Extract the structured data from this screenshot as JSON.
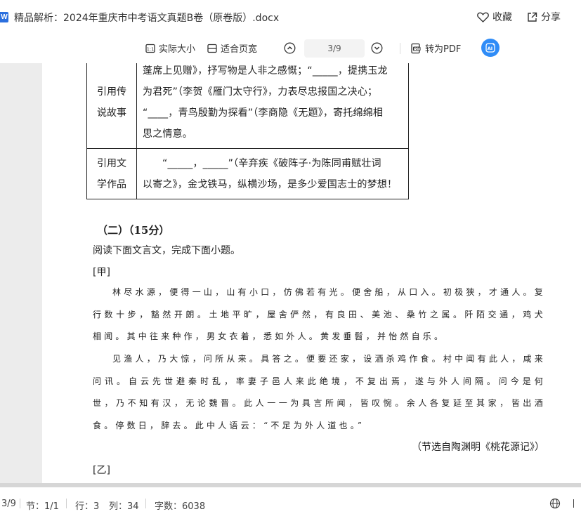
{
  "window": {
    "title": "精品解析：2024年重庆市中考语文真题B卷（原卷版）.docx",
    "app_icon_letter": "W",
    "actions": {
      "favorite": "收藏",
      "share": "分享"
    }
  },
  "toolbar": {
    "actual_size": "实际大小",
    "fit_width": "适合页宽",
    "page_indicator": "3/9",
    "to_pdf": "转为PDF",
    "ai_label": "AI"
  },
  "document": {
    "table": {
      "rows": [
        {
          "category": "引用传说故事",
          "category_lines": [
            "引用传",
            "说故事"
          ],
          "lines": [
            "蓬席上见赠》，抒写物是人非之感慨；“_____，提携玉龙",
            "为君死”（李贺《雁门太守行》，力表尽忠报国之决心；",
            "“____，青鸟殷勤为探看”（李商隐《无题》，寄托绵绵相",
            "思之情意。"
          ]
        },
        {
          "category": "引用文学作品",
          "category_lines": [
            "引用文",
            "学作品"
          ],
          "lines": [
            "“_____，_____”（辛弃疾《破阵子·为陈同甫赋壮词",
            "以寄之》，金戈铁马，纵横沙场，是多少爱国志士的梦想！"
          ]
        }
      ]
    },
    "section_heading": "（二）（15分）",
    "instruction": "阅读下面文言文，完成下面小题。",
    "label_jia": "[甲]",
    "passage_p1": "林尽水源，便得一山，山有小口，仿佛若有光。便舍船，从口入。初极狭，才通人。复行数十步，豁然开朗。土地平旷，屋舍俨然，有良田、美池、桑竹之属。阡陌交通，鸡犬相闻。其中往来种作，男女衣着，悉如外人。黄发垂髫，并怡然自乐。",
    "passage_p2": "见渔人，乃大惊，问所从来。具答之。便要还家，设酒杀鸡作食。村中闻有此人，咸来问讯。自云先世避秦时乱，率妻子邑人来此绝境，不复出焉，遂与外人间隔。问今是何世，乃不知有汉，无论魏晋。此人一一为具言所闻，皆叹惋。余人各复延至其家，皆出酒食。停数日，辞去。此中人语云：“不足为外人道也。”",
    "source": "（节选自陶渊明《桃花源记》）",
    "label_yi": "[乙]"
  },
  "statusbar": {
    "page": "3/9",
    "section": "节：1/1",
    "row": "行：3",
    "column": "列：34",
    "word_count": "字数：6038"
  },
  "colors": {
    "accent": "#2f8cf7",
    "app_icon": "#2b6fde"
  }
}
